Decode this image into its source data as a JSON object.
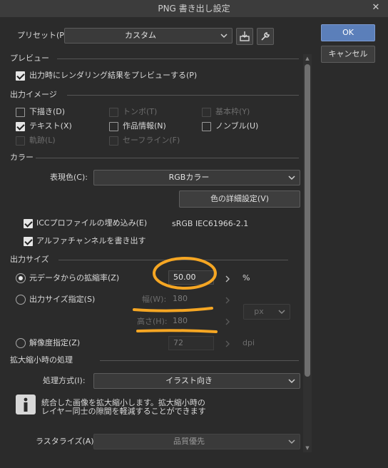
{
  "window": {
    "title": "PNG 書き出し設定"
  },
  "buttons": {
    "ok": "OK",
    "cancel": "キャンセル"
  },
  "preset": {
    "label": "プリセット(P):",
    "value": "カスタム"
  },
  "preview": {
    "section": "プレビュー",
    "checkbox": "出力時にレンダリング結果をプレビューする(P)"
  },
  "output_image": {
    "section": "出力イメージ",
    "items": [
      {
        "label": "下描き(D)",
        "checked": false,
        "enabled": true
      },
      {
        "label": "トンボ(T)",
        "checked": false,
        "enabled": false
      },
      {
        "label": "基本枠(Y)",
        "checked": false,
        "enabled": false
      },
      {
        "label": "テキスト(X)",
        "checked": true,
        "enabled": true
      },
      {
        "label": "作品情報(N)",
        "checked": false,
        "enabled": true
      },
      {
        "label": "ノンブル(U)",
        "checked": false,
        "enabled": true
      },
      {
        "label": "軌跡(L)",
        "checked": false,
        "enabled": false
      },
      {
        "label": "セーフライン(F)",
        "checked": false,
        "enabled": false
      }
    ]
  },
  "color": {
    "section": "カラー",
    "mode_label": "表現色(C):",
    "mode_value": "RGBカラー",
    "detail_button": "色の詳細設定(V)",
    "icc_label": "ICCプロファイルの埋め込み(E)",
    "icc_profile": "sRGB IEC61966-2.1",
    "alpha_label": "アルファチャンネルを書き出す"
  },
  "output_size": {
    "section": "出力サイズ",
    "scale_label": "元データからの拡縮率(Z)",
    "scale_value": "50.00",
    "scale_unit": "%",
    "size_label": "出力サイズ指定(S)",
    "width_label": "幅(W):",
    "width_value": "180",
    "height_label": "高さ(H):",
    "height_value": "180",
    "size_unit": "px",
    "resolution_label": "解像度指定(Z)",
    "resolution_value": "72",
    "resolution_unit": "dpi"
  },
  "scaling": {
    "section": "拡大縮小時の処理",
    "method_label": "処理方式(I):",
    "method_value": "イラスト向き",
    "info_line1": "統合した画像を拡大縮小します。拡大縮小時の",
    "info_line2": "レイヤー同士の隙間を軽減することができます",
    "rasterize_label": "ラスタライズ(A):",
    "rasterize_value": "品質優先"
  },
  "colors": {
    "accent_button": "#5b7fba",
    "annotation": "#f5a623"
  }
}
